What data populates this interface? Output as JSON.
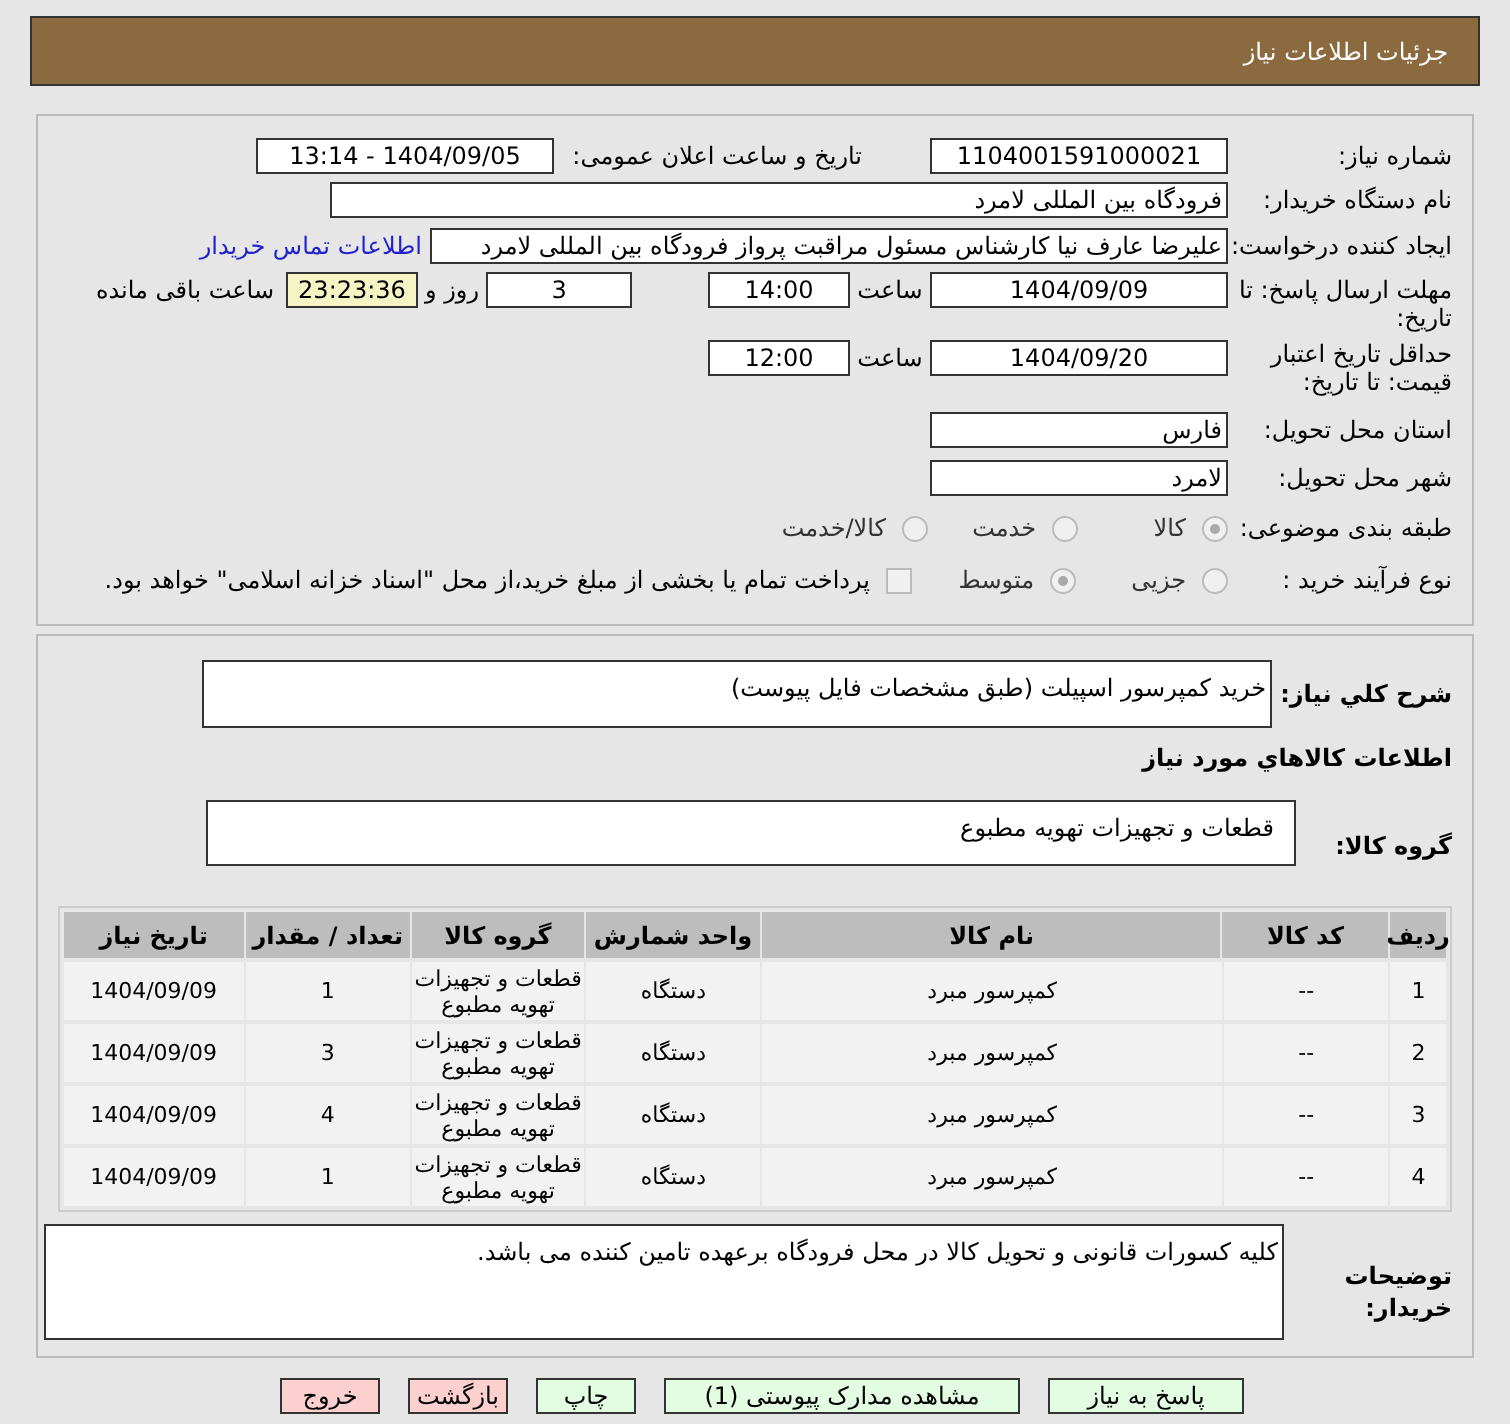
{
  "header": {
    "title": "جزئیات اطلاعات نیاز"
  },
  "form": {
    "need_number": {
      "label": "شماره نیاز:",
      "value": "1104001591000021"
    },
    "announce": {
      "label": "تاریخ و ساعت اعلان عمومی:",
      "value": "1404/09/05 - 13:14"
    },
    "buyer": {
      "label": "نام دستگاه خریدار:",
      "value": "فرودگاه بین المللی لامرد"
    },
    "creator": {
      "label": "ایجاد کننده درخواست:",
      "value": "علیرضا عارف نیا کارشناس مسئول مراقبت پرواز فرودگاه بین المللی لامرد",
      "link": "اطلاعات تماس خریدار"
    },
    "deadline": {
      "label": "مهلت ارسال پاسخ: تا تاریخ:",
      "date": "1404/09/09",
      "time_label": "ساعت",
      "time": "14:00",
      "days": "3",
      "days_label": "روز و",
      "remaining": "23:23:36",
      "remaining_label": "ساعت باقی مانده"
    },
    "validity": {
      "label": "حداقل تاریخ اعتبار قیمت: تا تاریخ:",
      "date": "1404/09/20",
      "time_label": "ساعت",
      "time": "12:00"
    },
    "province": {
      "label": "استان محل تحویل:",
      "value": "فارس"
    },
    "city": {
      "label": "شهر محل تحویل:",
      "value": "لامرد"
    },
    "category": {
      "label": "طبقه بندی موضوعی:",
      "options": [
        {
          "label": "كالا",
          "selected": true
        },
        {
          "label": "خدمت",
          "selected": false
        },
        {
          "label": "كالا/خدمت",
          "selected": false
        }
      ]
    },
    "process": {
      "label": "نوع فرآیند خرید :",
      "options": [
        {
          "label": "جزیی",
          "selected": false
        },
        {
          "label": "متوسط",
          "selected": true
        }
      ],
      "checkbox": {
        "checked": false,
        "label": "پرداخت تمام یا بخشی از مبلغ خرید،از محل \"اسناد خزانه اسلامی\" خواهد بود."
      }
    }
  },
  "description": {
    "label": "شرح كلي نياز:",
    "value": "خرید کمپرسور  اسپیلت (طبق مشخصات فایل پیوست)"
  },
  "goods_title": "اطلاعات كالاهاي مورد نياز",
  "goods_group": {
    "label": "گروه کالا:",
    "value": "قطعات و تجهیزات تهویه مطبوع"
  },
  "table": {
    "columns": [
      "ردیف",
      "کد کالا",
      "نام کالا",
      "واحد شمارش",
      "گروه کالا",
      "تعداد / مقدار",
      "تاریخ نیاز"
    ],
    "rows": [
      [
        "1",
        "--",
        "کمپرسور مبرد",
        "دستگاه",
        "قطعات و تجهیزات تهویه مطبوع",
        "1",
        "1404/09/09"
      ],
      [
        "2",
        "--",
        "کمپرسور مبرد",
        "دستگاه",
        "قطعات و تجهیزات تهویه مطبوع",
        "3",
        "1404/09/09"
      ],
      [
        "3",
        "--",
        "کمپرسور مبرد",
        "دستگاه",
        "قطعات و تجهیزات تهویه مطبوع",
        "4",
        "1404/09/09"
      ],
      [
        "4",
        "--",
        "کمپرسور مبرد",
        "دستگاه",
        "قطعات و تجهیزات تهویه مطبوع",
        "1",
        "1404/09/09"
      ]
    ]
  },
  "buyer_notes": {
    "label": "توضیحات خریدار:",
    "value": "کلیه کسورات قانونی و تحویل کالا در محل فرودگاه برعهده تامین کننده می باشد."
  },
  "buttons": [
    {
      "label": "پاسخ به نیاز",
      "kind": "normal"
    },
    {
      "label": "مشاهده مدارک پیوستی (1)",
      "kind": "normal"
    },
    {
      "label": "چاپ",
      "kind": "normal"
    },
    {
      "label": "بازگشت",
      "kind": "danger"
    },
    {
      "label": "خروج",
      "kind": "danger"
    }
  ]
}
